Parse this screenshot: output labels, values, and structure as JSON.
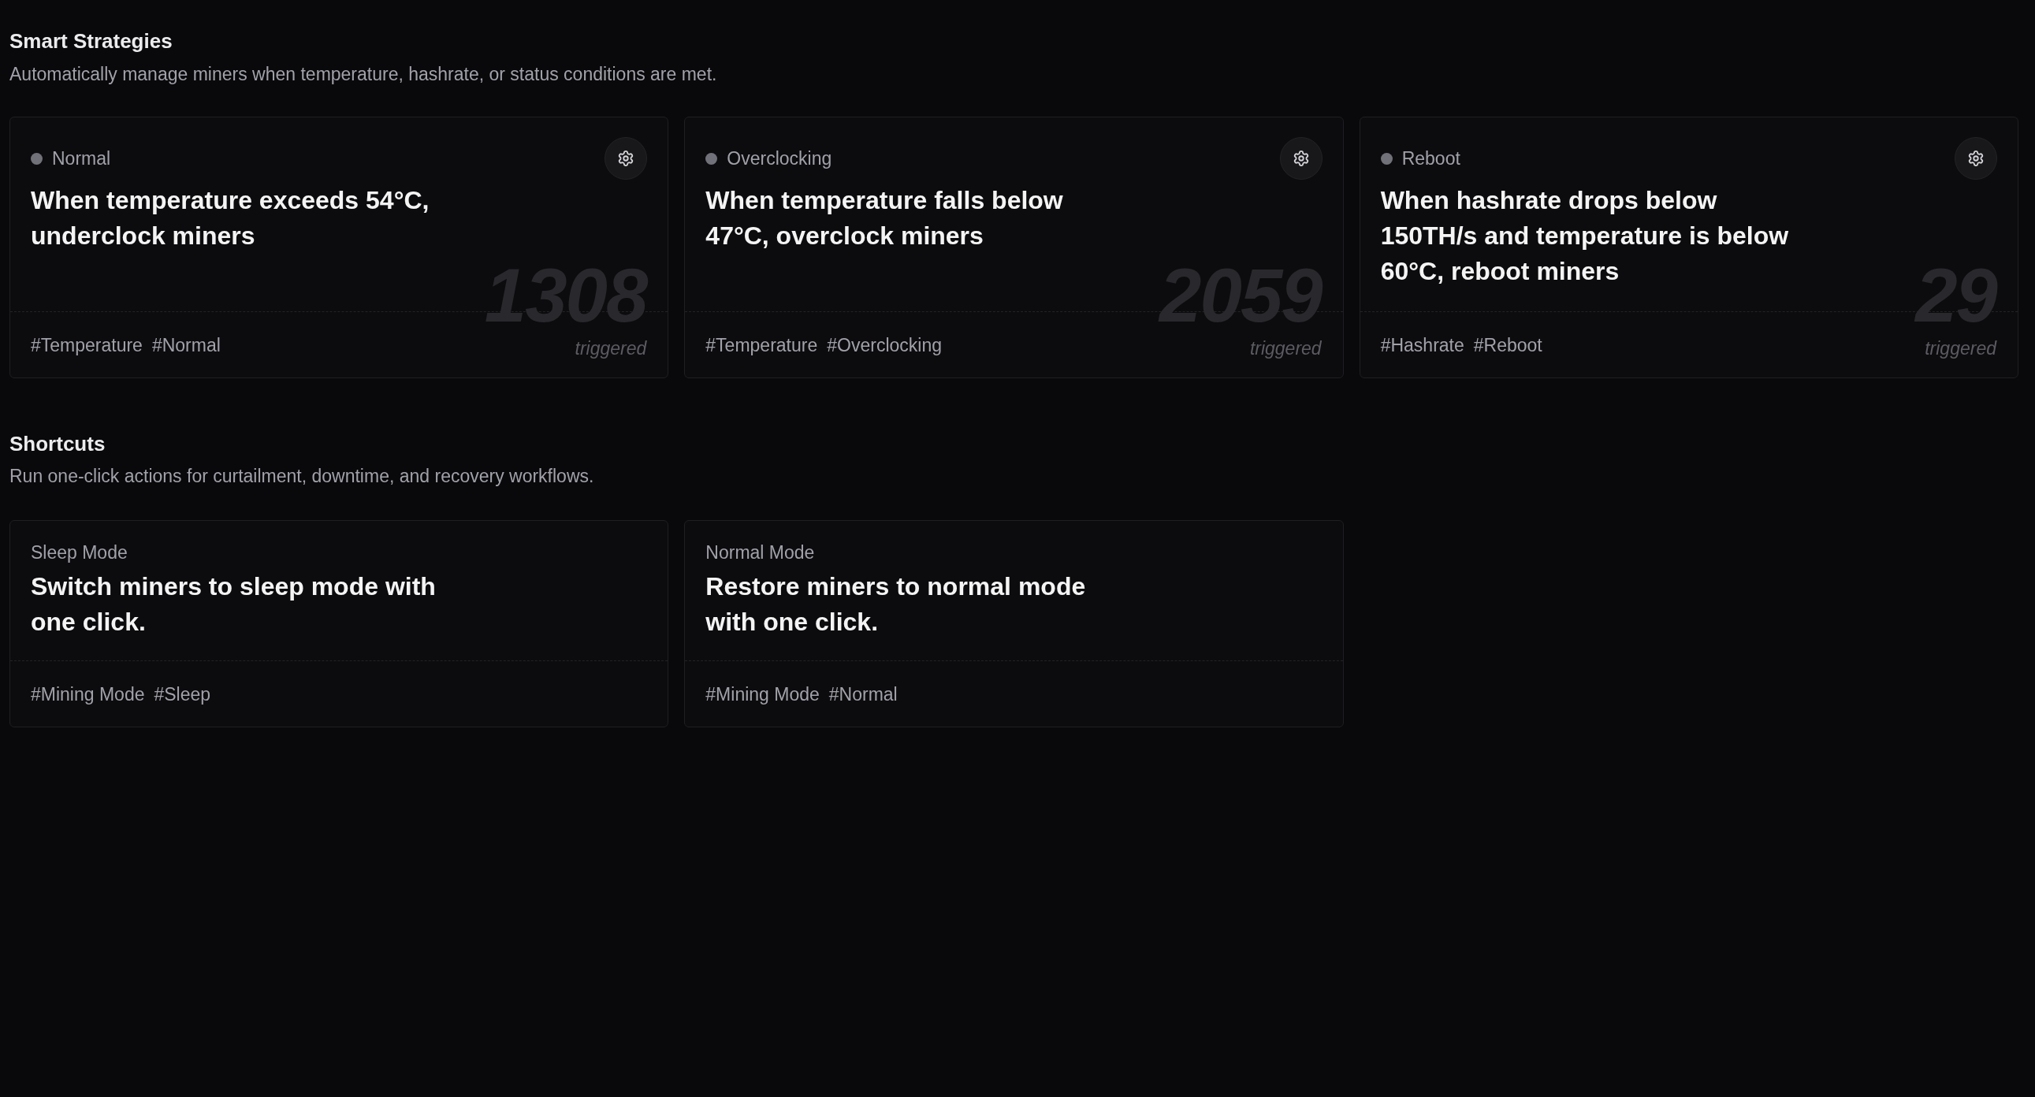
{
  "smart_strategies": {
    "title": "Smart Strategies",
    "description": "Automatically manage miners when temperature, hashrate, or status conditions are met.",
    "cards": [
      {
        "mode": "Normal",
        "color": "#71717a",
        "title": "When temperature exceeds 54°C, underclock miners",
        "count": "1308",
        "count_label": "triggered",
        "tags": [
          "#Temperature",
          "#Normal"
        ]
      },
      {
        "mode": "Overclocking",
        "color": "#71717a",
        "title": "When temperature falls below 47°C, overclock miners",
        "count": "2059",
        "count_label": "triggered",
        "tags": [
          "#Temperature",
          "#Overclocking"
        ]
      },
      {
        "mode": "Reboot",
        "color": "#71717a",
        "title": "When hashrate drops below 150TH/s and temperature is below 60°C, reboot miners",
        "count": "29",
        "count_label": "triggered",
        "tags": [
          "#Hashrate",
          "#Reboot"
        ]
      }
    ]
  },
  "shortcuts": {
    "title": "Shortcuts",
    "description": "Run one-click actions for curtailment, downtime, and recovery workflows.",
    "cards": [
      {
        "mode": "Sleep Mode",
        "title": "Switch miners to sleep mode with one click.",
        "tags": [
          "#Mining Mode",
          "#Sleep"
        ]
      },
      {
        "mode": "Normal Mode",
        "title": "Restore miners to normal mode with one click.",
        "tags": [
          "#Mining Mode",
          "#Normal"
        ]
      }
    ]
  }
}
